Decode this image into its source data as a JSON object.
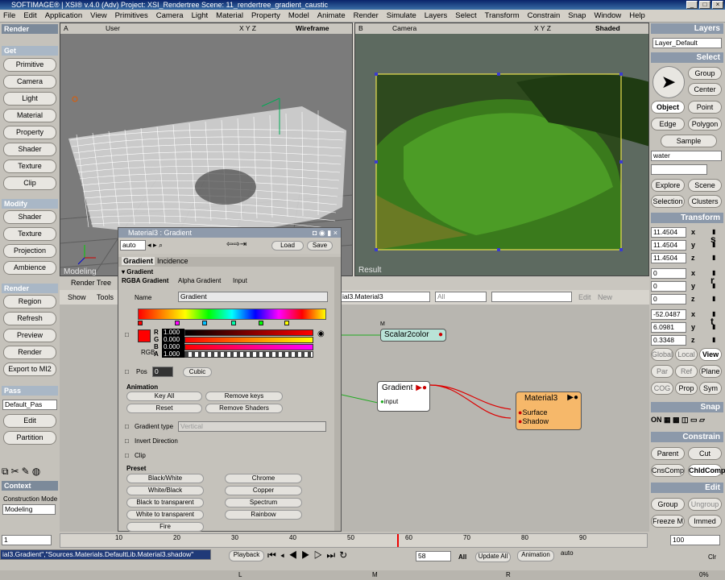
{
  "window": {
    "title": "SOFTIMAGE® | XSI® v.4.0 (Adv) Project: XSI_Rendertree     Scene: 11_rendertree_gradient_caustic"
  },
  "menu": [
    "File",
    "Edit",
    "Application",
    "View",
    "Primitives",
    "Camera",
    "Light",
    "Material",
    "Property",
    "Model",
    "Animate",
    "Render",
    "Simulate",
    "Layers",
    "Select",
    "Transform",
    "Constrain",
    "Snap",
    "Window",
    "Help"
  ],
  "left": {
    "header": "Render",
    "get_title": "Get",
    "get_items": [
      "Primitive",
      "Camera",
      "Light",
      "Material",
      "Property",
      "Shader",
      "Texture",
      "Clip"
    ],
    "modify_title": "Modify",
    "modify_items": [
      "Shader",
      "Texture",
      "Projection",
      "Ambience"
    ],
    "render_title": "Render",
    "render_items": [
      "Region",
      "Refresh",
      "Preview",
      "Render",
      "Export to MI2"
    ],
    "pass_title": "Pass",
    "pass_value": "Default_Pas",
    "pass_items": [
      "Edit",
      "Partition"
    ],
    "context_label": "Context",
    "construction_label": "Construction Mode",
    "construction_value": "Modeling"
  },
  "viewA": {
    "letter": "A",
    "camera": "User",
    "axes": "X Y Z",
    "mode": "Wireframe",
    "label": "Modeling"
  },
  "viewB": {
    "letter": "B",
    "camera": "Camera",
    "axes": "X Y Z",
    "mode": "Shaded",
    "label": "Result"
  },
  "rendertree": {
    "tab": "Render Tree",
    "show": "Show",
    "tools": "Tools",
    "path": "ial3.Material3",
    "all": "All",
    "edit": "Edit",
    "new": "New"
  },
  "nodes": {
    "scalar": "Scalar2color",
    "gradient": "Gradient",
    "gradient_port": "input",
    "material": "Material3",
    "mat_ports": [
      "Surface",
      "Shadow"
    ]
  },
  "ppg": {
    "title": "Material3 : Gradient",
    "auto": "auto",
    "load": "Load",
    "save": "Save",
    "tabs": [
      "Gradient",
      "Incidence"
    ],
    "section": "Gradient",
    "subtabs": [
      "RGBA Gradient",
      "Alpha Gradient",
      "Input"
    ],
    "name_label": "Name",
    "name_value": "Gradient",
    "rgba": [
      {
        "k": "R",
        "v": "1.000"
      },
      {
        "k": "G",
        "v": "0.000"
      },
      {
        "k": "B",
        "v": "0.000"
      },
      {
        "k": "A",
        "v": "1.000"
      }
    ],
    "rgb_label": "RGB",
    "pos_label": "Pos",
    "pos_value": "0",
    "interp": "Cubic",
    "animation": "Animation",
    "anim_buttons": [
      "Key All",
      "Remove keys",
      "Reset",
      "Remove Shaders"
    ],
    "gradient_type_label": "Gradient type",
    "gradient_type_value": "Vertical",
    "invert": "Invert Direction",
    "clip": "Clip",
    "preset": "Preset",
    "presets": [
      "Black/White",
      "Chrome",
      "White/Black",
      "Copper",
      "Black to transparent",
      "Spectrum",
      "White to transparent",
      "Rainbow",
      "Fire"
    ]
  },
  "right": {
    "layers_title": "Layers",
    "layer_value": "Layer_Default",
    "select_title": "Select",
    "select_buttons": [
      "Group",
      "Center",
      "Object",
      "Point",
      "Edge",
      "Polygon",
      "Sample"
    ],
    "select_field": "water",
    "explore": [
      "Explore",
      "Scene",
      "Selection",
      "Clusters"
    ],
    "transform_title": "Transform",
    "s_values": [
      "11.4504",
      "11.4504",
      "11.4504"
    ],
    "r_values": [
      "0",
      "0",
      "0"
    ],
    "t_values": [
      "-52.0487",
      "6.0981",
      "0.3348"
    ],
    "axis_letters": [
      "x",
      "y",
      "z"
    ],
    "srt": [
      "s",
      "r",
      "t"
    ],
    "ref": [
      "Global",
      "Local",
      "View",
      "Par",
      "Ref",
      "Plane",
      "COG",
      "Prop",
      "Sym"
    ],
    "snap_title": "Snap",
    "snap_on": "ON",
    "constrain_title": "Constrain",
    "constrain_buttons": [
      "Parent",
      "Cut",
      "CnsComp",
      "ChldComp"
    ],
    "edit_title": "Edit",
    "edit_buttons": [
      "Group",
      "Ungroup",
      "Freeze M",
      "Immed"
    ],
    "frame_end": "100"
  },
  "timeline": {
    "start": "1",
    "ticks": [
      "10",
      "20",
      "30",
      "40",
      "50",
      "60",
      "70",
      "80",
      "90"
    ],
    "cmdline": "ial3.Gradient\",\"Sources.Materials.DefaultLib.Material3.shadow\"",
    "playback": "Playback",
    "frame": "58",
    "all": "All",
    "update": "Update All",
    "animation": "Animation",
    "auto": "auto",
    "clr": "Clr",
    "zoom": "0%",
    "mouse": [
      "L",
      "M",
      "R"
    ]
  },
  "colors": {
    "node_orange": "#f6b86a",
    "node_teal": "#b9e3d7",
    "rgba_red": "#ff0000",
    "selection": "#ffff66"
  }
}
